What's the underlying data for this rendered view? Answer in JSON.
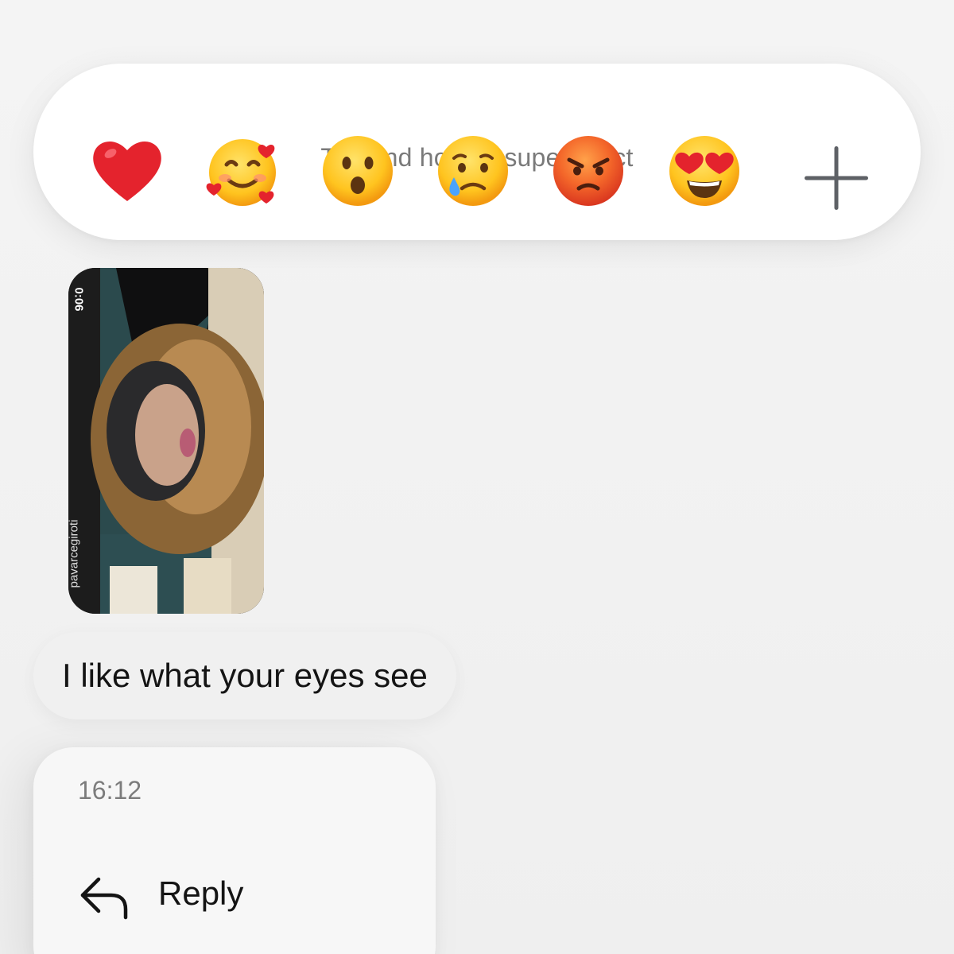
{
  "reaction_bar": {
    "hint": "Tap and hold to super react",
    "reactions": [
      {
        "name": "red-heart-icon",
        "glyph": "❤️"
      },
      {
        "name": "smiling-face-with-hearts-icon",
        "glyph": "🥰"
      },
      {
        "name": "face-with-open-mouth-icon",
        "glyph": "😮"
      },
      {
        "name": "crying-face-icon",
        "glyph": "😢"
      },
      {
        "name": "angry-face-icon",
        "glyph": "😡"
      },
      {
        "name": "heart-eyes-icon",
        "glyph": "😍"
      }
    ],
    "more": {
      "name": "plus-icon",
      "glyph": "+"
    }
  },
  "video_message": {
    "duration": "0:06",
    "watermark": "pavarcegiroti"
  },
  "text_message": {
    "text": "I like what your eyes see"
  },
  "context_menu": {
    "time": "16:12",
    "reply_label": "Reply"
  },
  "colors": {
    "background": "#f2f2f2",
    "surface": "#ffffff",
    "secondary_text": "#7a7a7a",
    "primary_text": "#141414"
  }
}
